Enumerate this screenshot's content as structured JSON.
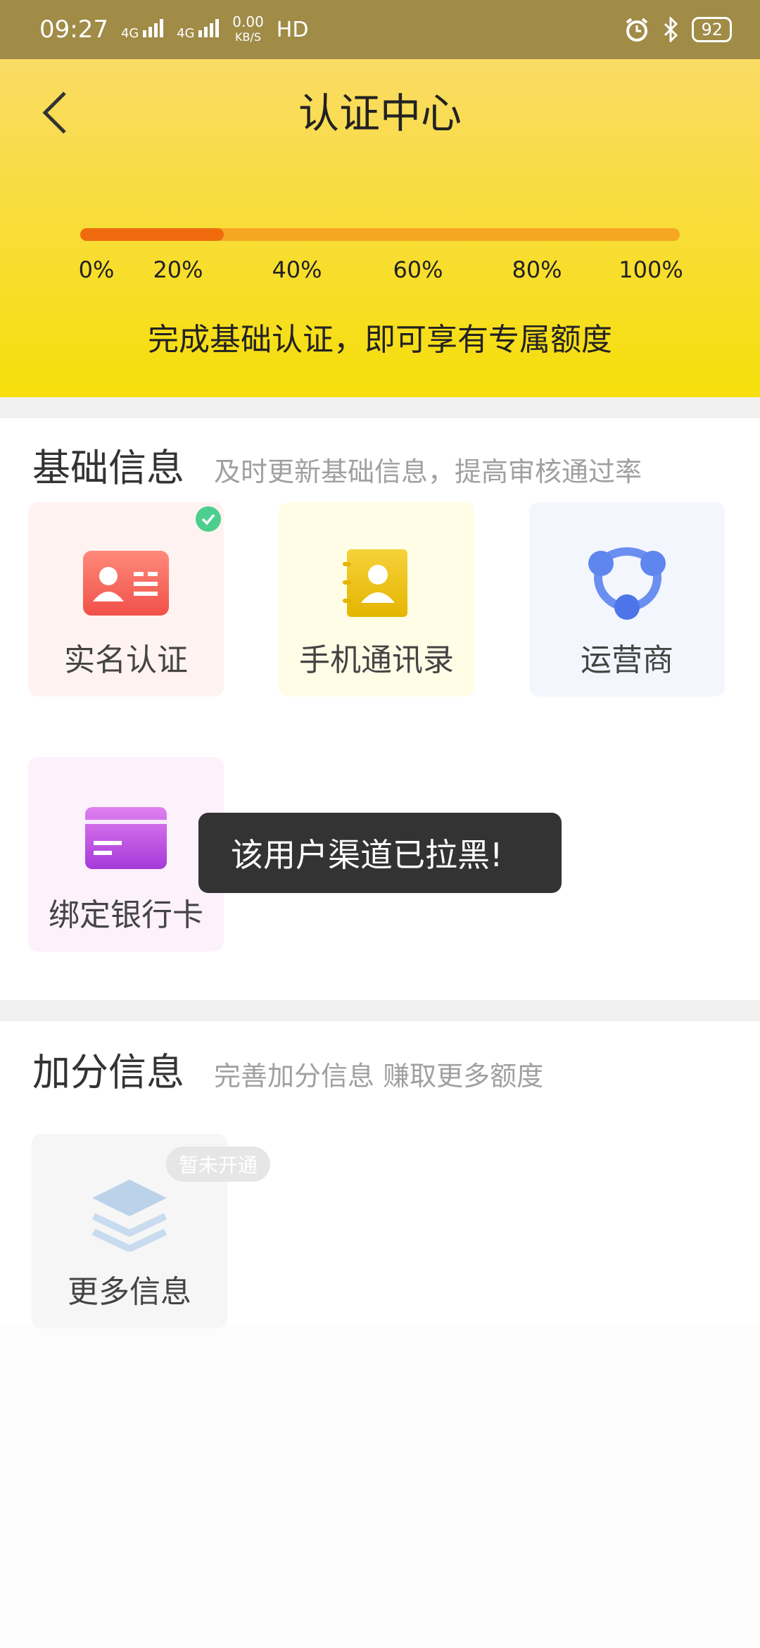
{
  "status_bar": {
    "time": "09:27",
    "net1": "4G",
    "net2": "4G",
    "speed_value": "0.00",
    "speed_unit": "KB/S",
    "hd": "HD",
    "battery": "92",
    "icons": [
      "signal-icon",
      "alarm-icon",
      "bluetooth-icon",
      "battery-icon"
    ]
  },
  "header": {
    "title": "认证中心",
    "back_icon": "chevron-left-icon",
    "progress": {
      "fraction": 0.2
    },
    "ticks": [
      "0%",
      "20%",
      "40%",
      "60%",
      "80%",
      "100%"
    ],
    "note": "完成基础认证，即可享有专属额度"
  },
  "basic": {
    "title": "基础信息",
    "subtitle": "及时更新基础信息，提高审核通过率",
    "items": [
      {
        "label": "实名认证",
        "icon": "id-card-icon",
        "completed": true,
        "bg": "#fff3f1"
      },
      {
        "label": "手机通讯录",
        "icon": "contacts-book-icon",
        "completed": false,
        "bg": "#fffde6"
      },
      {
        "label": "运营商",
        "icon": "carrier-network-icon",
        "completed": false,
        "bg": "#f3f6fd"
      },
      {
        "label": "绑定银行卡",
        "icon": "bank-card-icon",
        "completed": false,
        "bg": "#fdf1fb"
      }
    ]
  },
  "bonus": {
    "title": "加分信息",
    "subtitle": "完善加分信息 赚取更多额度",
    "items": [
      {
        "label": "更多信息",
        "icon": "layers-icon",
        "badge": "暂未开通",
        "bg": "#f6f6f6"
      }
    ]
  },
  "toast": {
    "text": "该用户渠道已拉黑!"
  },
  "colors": {
    "status_bar": "#a08b47",
    "header_top": "#fadb65",
    "header_bottom": "#f6df0a",
    "progress_track": "#f6a623",
    "progress_fill": "#ee6a0d",
    "success": "#4cce8f"
  }
}
